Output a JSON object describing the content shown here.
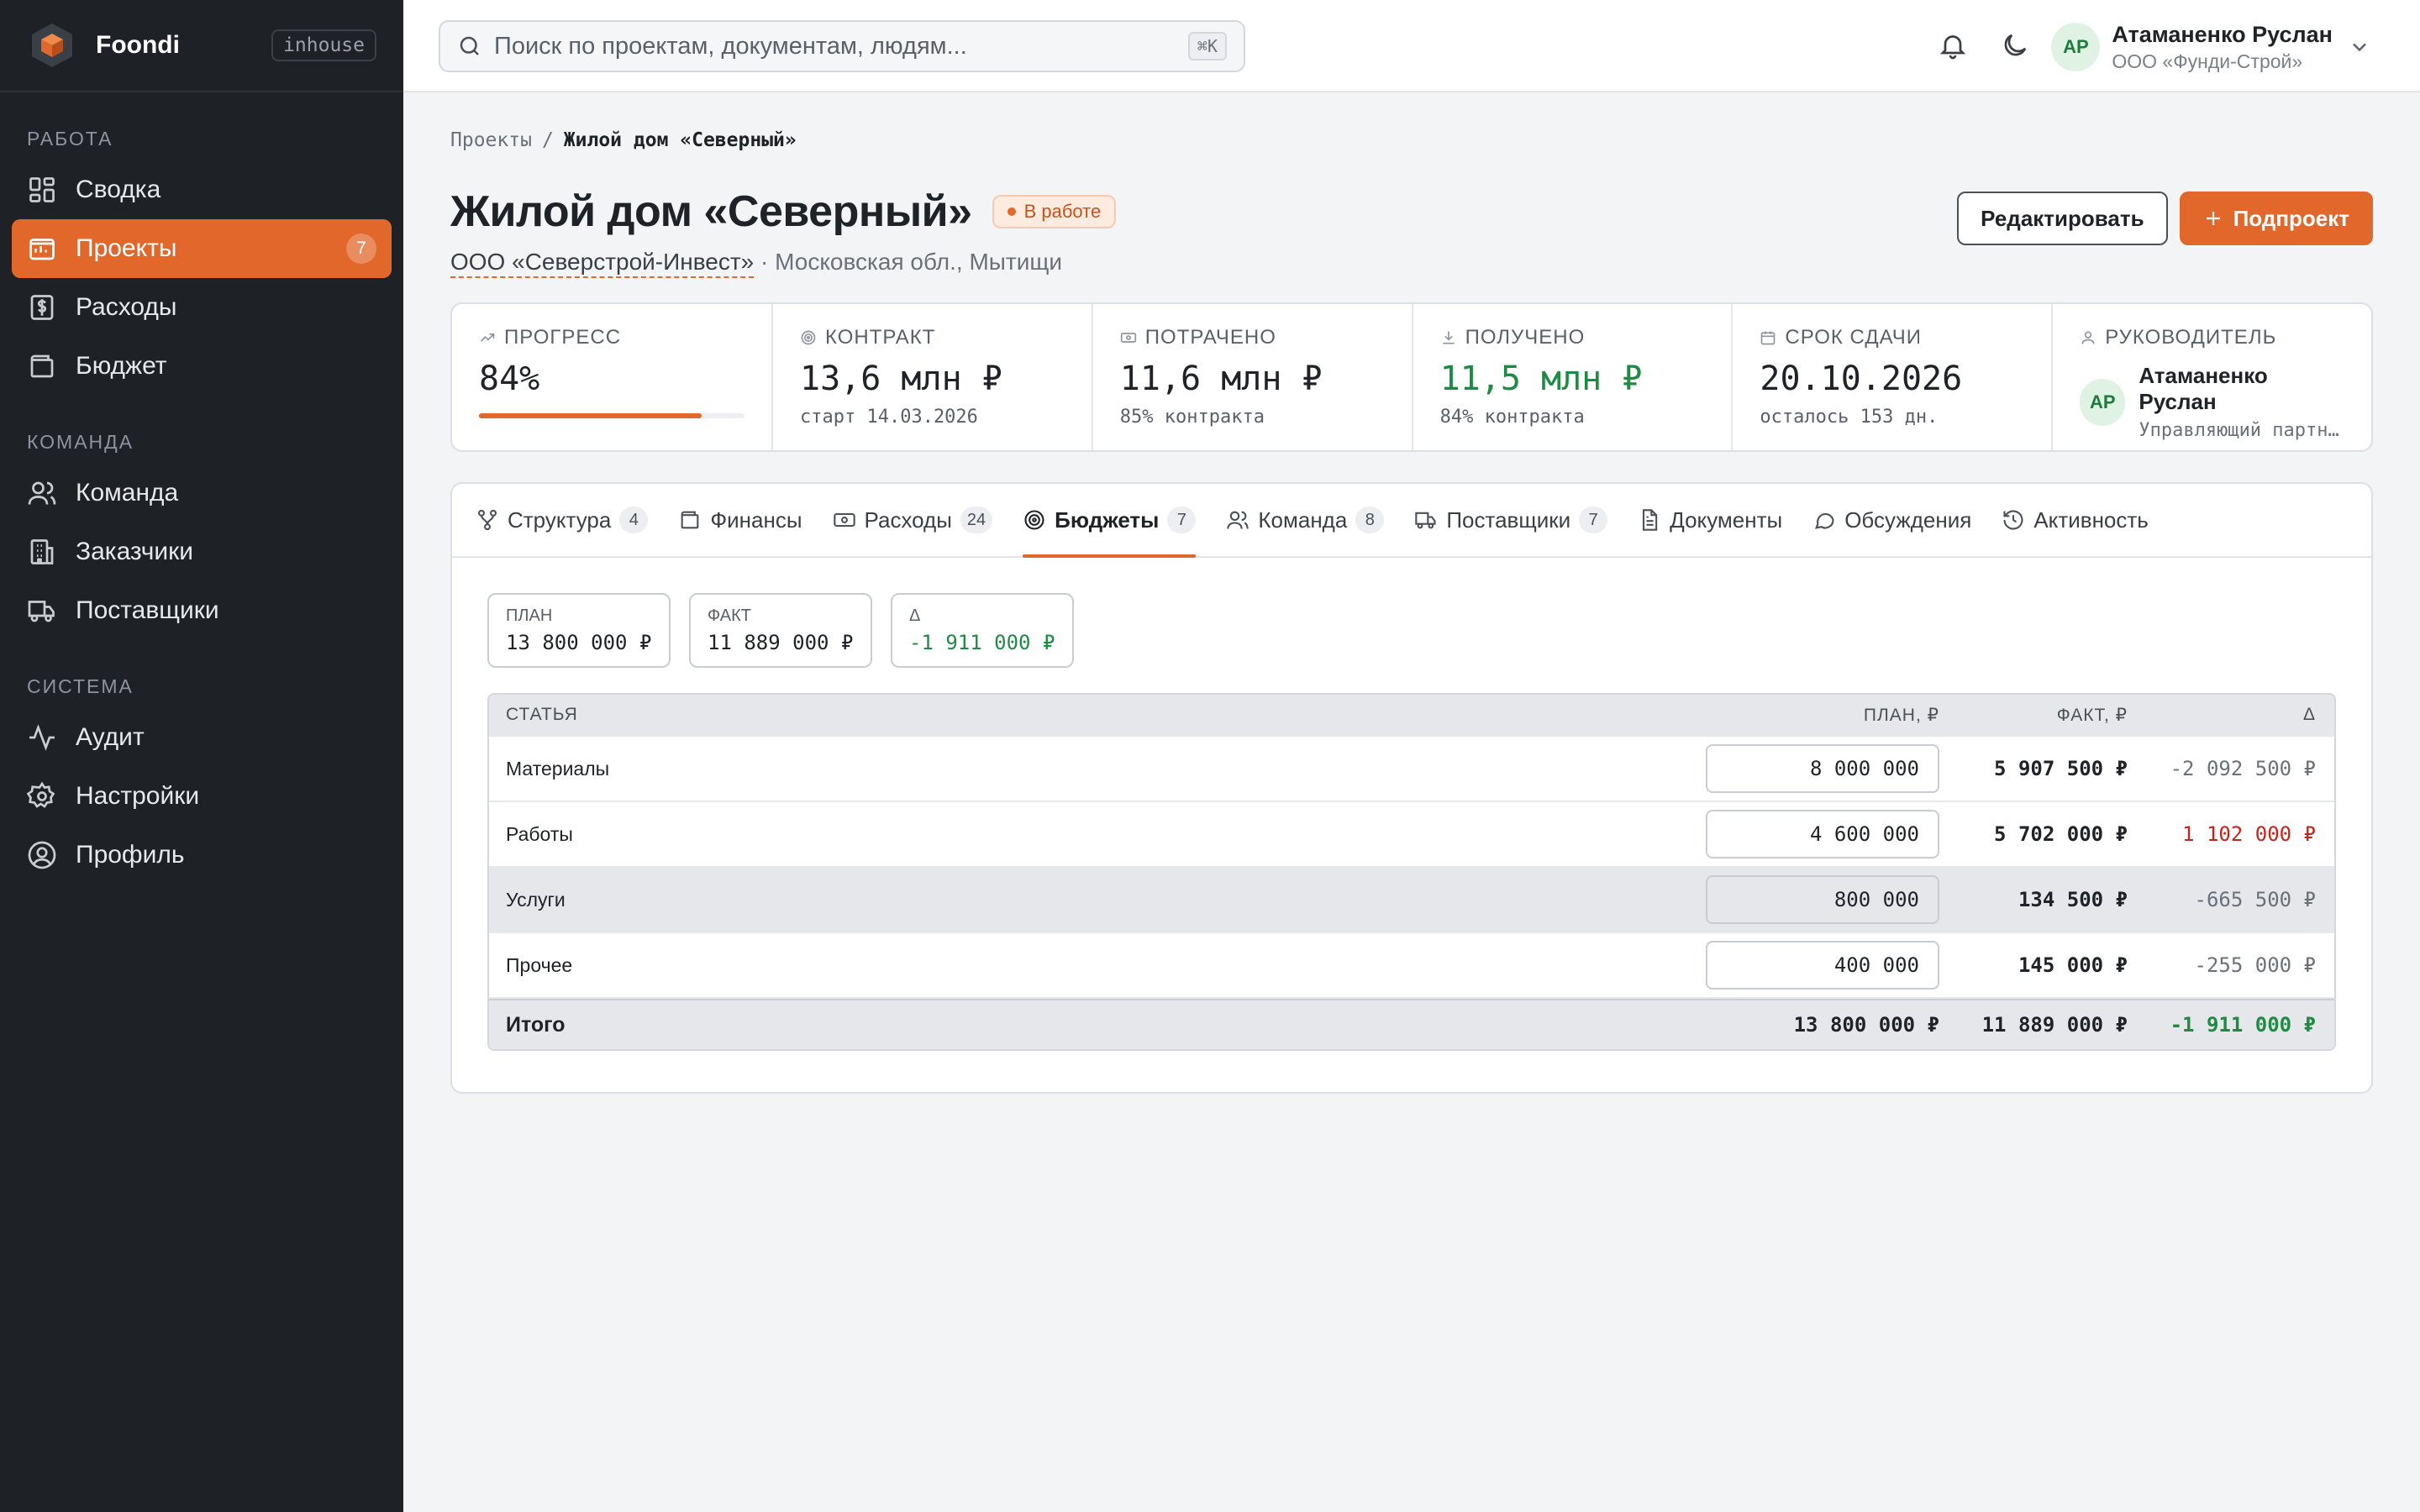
{
  "brand": {
    "name": "Foondi",
    "tag": "inhouse"
  },
  "sidebar": {
    "sections": [
      {
        "title": "Работа",
        "items": [
          {
            "label": "Сводка",
            "icon": "dashboard-icon"
          },
          {
            "label": "Проекты",
            "icon": "projects-icon",
            "badge": "7",
            "active": true
          },
          {
            "label": "Расходы",
            "icon": "expenses-icon"
          },
          {
            "label": "Бюджет",
            "icon": "wallet-icon"
          }
        ]
      },
      {
        "title": "Команда",
        "items": [
          {
            "label": "Команда",
            "icon": "users-icon"
          },
          {
            "label": "Заказчики",
            "icon": "building-icon"
          },
          {
            "label": "Поставщики",
            "icon": "truck-icon"
          }
        ]
      },
      {
        "title": "Система",
        "items": [
          {
            "label": "Аудит",
            "icon": "activity-icon"
          },
          {
            "label": "Настройки",
            "icon": "gear-icon"
          },
          {
            "label": "Профиль",
            "icon": "user-circle-icon"
          }
        ]
      }
    ]
  },
  "header": {
    "search_placeholder": "Поиск по проектам, документам, людям...",
    "search_shortcut": "⌘K",
    "user": {
      "initials": "АР",
      "name": "Атаманенко Руслан",
      "org": "ООО «Фунди-Строй»"
    }
  },
  "breadcrumb": {
    "parent": "Проекты",
    "separator": "/",
    "current": "Жилой дом «Северный»"
  },
  "project": {
    "title": "Жилой дом «Северный»",
    "status": "В работе",
    "client": "ООО «Северстрой-Инвест»",
    "location": " · Московская обл., Мытищи"
  },
  "actions": {
    "edit": "Редактировать",
    "subproject": "Подпроект"
  },
  "stats": {
    "progress": {
      "label": "Прогресс",
      "value": "84%",
      "fraction": 0.84
    },
    "contract": {
      "label": "Контракт",
      "value": "13,6 млн ₽",
      "sub": "старт 14.03.2026"
    },
    "spent": {
      "label": "Потрачено",
      "value": "11,6 млн ₽",
      "sub": "85% контракта"
    },
    "received": {
      "label": "Получено",
      "value": "11,5 млн ₽",
      "sub": "84% контракта"
    },
    "deadline": {
      "label": "Срок сдачи",
      "value": "20.10.2026",
      "sub": "осталось 153 дн."
    },
    "manager": {
      "label": "Руководитель",
      "initials": "АР",
      "name": "Атаманенко Руслан",
      "role": "Управляющий партн…"
    }
  },
  "tabs": [
    {
      "label": "Структура",
      "count": "4",
      "icon": "structure-icon"
    },
    {
      "label": "Финансы",
      "count": "",
      "icon": "wallet-icon"
    },
    {
      "label": "Расходы",
      "count": "24",
      "icon": "banknote-icon"
    },
    {
      "label": "Бюджеты",
      "count": "7",
      "icon": "target-icon",
      "active": true
    },
    {
      "label": "Команда",
      "count": "8",
      "icon": "users-icon"
    },
    {
      "label": "Поставщики",
      "count": "7",
      "icon": "truck-icon"
    },
    {
      "label": "Документы",
      "count": "",
      "icon": "document-icon"
    },
    {
      "label": "Обсуждения",
      "count": "",
      "icon": "chat-icon"
    },
    {
      "label": "Активность",
      "count": "",
      "icon": "history-icon"
    }
  ],
  "budget_summary": {
    "plan": {
      "label": "ПЛАН",
      "value": "13 800 000 ₽"
    },
    "fact": {
      "label": "ФАКТ",
      "value": "11 889 000 ₽"
    },
    "delta": {
      "label": "Δ",
      "value": "-1 911 000 ₽"
    }
  },
  "budget_table": {
    "headers": {
      "item": "СТАТЬЯ",
      "plan": "ПЛАН, ₽",
      "fact": "ФАКТ, ₽",
      "delta": "Δ"
    },
    "rows": [
      {
        "item": "Материалы",
        "plan": "8 000 000",
        "fact": "5 907 500 ₽",
        "delta": "-2 092 500 ₽"
      },
      {
        "item": "Работы",
        "plan": "4 600 000",
        "fact": "5 702 000 ₽",
        "delta": "1 102 000 ₽"
      },
      {
        "item": "Услуги",
        "plan": "800 000",
        "fact": "134 500 ₽",
        "delta": "-665 500 ₽"
      },
      {
        "item": "Прочее",
        "plan": "400 000",
        "fact": "145 000 ₽",
        "delta": "-255 000 ₽"
      }
    ],
    "total": {
      "item": "Итого",
      "plan": "13 800 000 ₽",
      "fact": "11 889 000 ₽",
      "delta": "-1 911 000 ₽"
    }
  },
  "colors": {
    "accent": "#e2672b",
    "sidebar_bg": "#1e2227",
    "positive": "#1f8a43",
    "negative": "#c0261d"
  }
}
